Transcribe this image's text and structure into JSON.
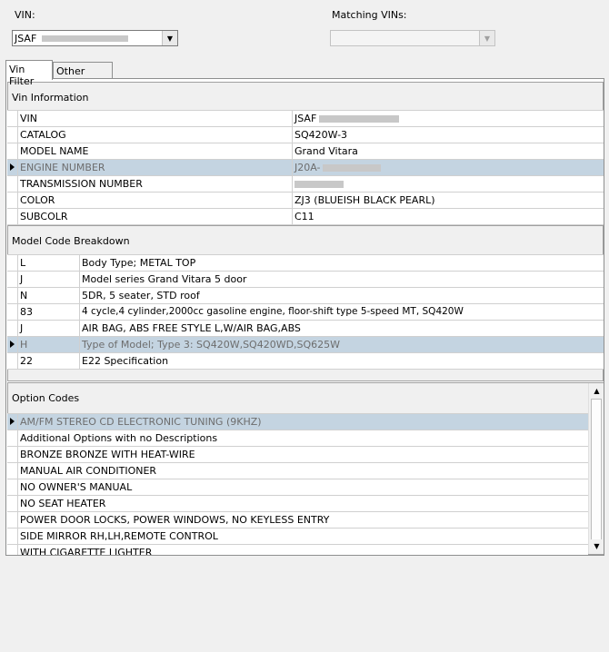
{
  "header": {
    "vin_label": "VIN:",
    "vin_value": "JSAF",
    "matching_label": "Matching VINs:",
    "matching_value": ""
  },
  "tabs": [
    {
      "label": "Vin Filter",
      "active": true
    },
    {
      "label": "Other Filters",
      "active": false
    }
  ],
  "vin_info": {
    "title": "Vin Information",
    "rows": [
      {
        "field": "VIN",
        "value": "JSAF",
        "selected": false
      },
      {
        "field": "CATALOG",
        "value": "SQ420W-3",
        "selected": false
      },
      {
        "field": "MODEL NAME",
        "value": "Grand Vitara",
        "selected": false
      },
      {
        "field": "ENGINE NUMBER",
        "value": "J20A-",
        "selected": true
      },
      {
        "field": "TRANSMISSION NUMBER",
        "value": "",
        "selected": false
      },
      {
        "field": "COLOR",
        "value": "ZJ3 (BLUEISH BLACK PEARL)",
        "selected": false
      },
      {
        "field": "SUBCOLR",
        "value": "C11",
        "selected": false
      }
    ]
  },
  "model_code": {
    "title": "Model Code Breakdown",
    "rows": [
      {
        "code": "L",
        "desc": "Body Type; METAL TOP",
        "selected": false
      },
      {
        "code": "J",
        "desc": "Model series Grand Vitara 5 door",
        "selected": false
      },
      {
        "code": "N",
        "desc": "5DR, 5 seater, STD roof",
        "selected": false
      },
      {
        "code": "83",
        "desc": "4 cycle,4 cylinder,2000cc gasoline engine, floor-shift type 5-speed MT, SQ420W",
        "selected": false
      },
      {
        "code": "J",
        "desc": "AIR BAG, ABS FREE STYLE L,W/AIR BAG,ABS",
        "selected": false
      },
      {
        "code": "H",
        "desc": "Type of Model; Type 3: SQ420W,SQ420WD,SQ625W",
        "selected": true
      },
      {
        "code": "22",
        "desc": "E22 Specification",
        "selected": false
      }
    ]
  },
  "option_codes": {
    "title": "Option Codes",
    "rows": [
      {
        "desc": "AM/FM STEREO CD ELECTRONIC TUNING (9KHZ)",
        "selected": true
      },
      {
        "desc": "Additional Options with no Descriptions",
        "selected": false
      },
      {
        "desc": "BRONZE BRONZE WITH HEAT-WIRE",
        "selected": false
      },
      {
        "desc": "MANUAL AIR CONDITIONER",
        "selected": false
      },
      {
        "desc": "NO OWNER'S MANUAL",
        "selected": false
      },
      {
        "desc": "NO SEAT HEATER",
        "selected": false
      },
      {
        "desc": "POWER DOOR LOCKS, POWER WINDOWS, NO KEYLESS ENTRY",
        "selected": false
      },
      {
        "desc": "SIDE MIRROR RH,LH,REMOTE CONTROL",
        "selected": false
      },
      {
        "desc": "WITH CIGARETTE LIGHTER",
        "selected": false
      }
    ]
  },
  "icons": {
    "dropdown": "chevron-down-icon",
    "row_pointer": "row-pointer-icon",
    "scroll_up": "scroll-up-icon",
    "scroll_down": "scroll-down-icon"
  },
  "colors": {
    "selected_row": "#c4d4e1",
    "panel_bg": "#f0f0f0"
  }
}
